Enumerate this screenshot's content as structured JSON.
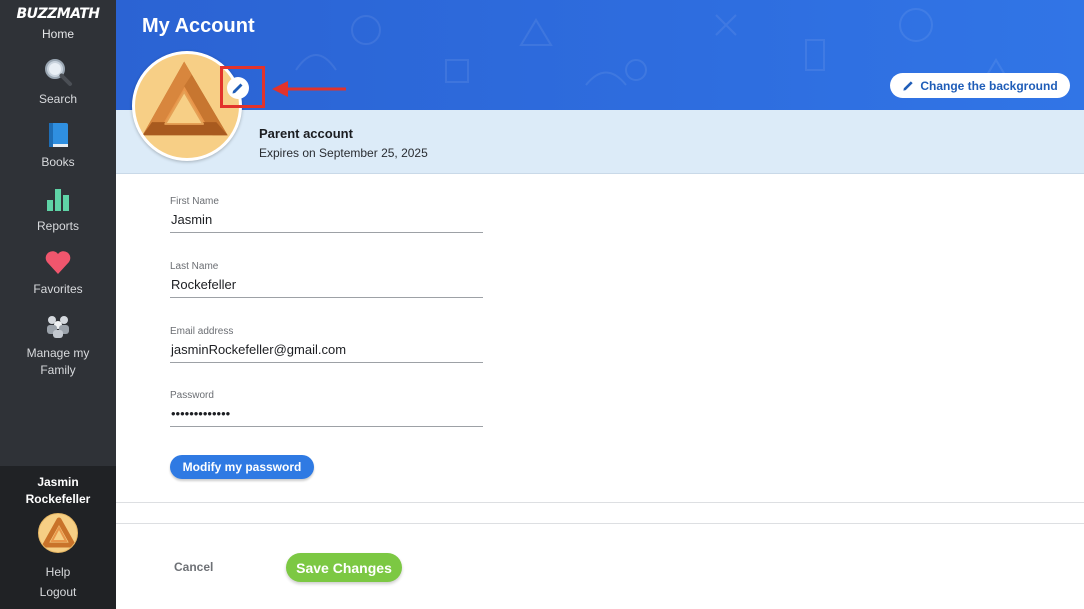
{
  "sidebar": {
    "brand": "BUZZMATH",
    "home_label": "Home",
    "items": [
      {
        "label": "Search",
        "icon": "magnifier-icon"
      },
      {
        "label": "Books",
        "icon": "book-icon"
      },
      {
        "label": "Reports",
        "icon": "bar-chart-icon"
      },
      {
        "label": "Favorites",
        "icon": "heart-icon"
      },
      {
        "label": "Manage my Family",
        "icon": "family-icon"
      }
    ],
    "user": {
      "name_first": "Jasmin",
      "name_last": "Rockefeller",
      "help": "Help",
      "logout": "Logout"
    }
  },
  "header": {
    "title": "My Account",
    "change_background": "Change the background"
  },
  "account": {
    "type": "Parent account",
    "expires": "Expires on September 25, 2025"
  },
  "form": {
    "first_name": {
      "label": "First Name",
      "value": "Jasmin"
    },
    "last_name": {
      "label": "Last Name",
      "value": "Rockefeller"
    },
    "email": {
      "label": "Email address",
      "value": "jasminRockefeller@gmail.com"
    },
    "password": {
      "label": "Password",
      "value": "•••••••••••••"
    },
    "modify_password": "Modify my password"
  },
  "actions": {
    "cancel": "Cancel",
    "save": "Save Changes"
  },
  "colors": {
    "sidebar_bg": "#2f3237",
    "banner_blue": "#2e6ddf",
    "band_light_blue": "#dcebf8",
    "primary_button": "#2f7ae3",
    "save_green": "#7cc843",
    "highlight_red": "#e2332b"
  }
}
